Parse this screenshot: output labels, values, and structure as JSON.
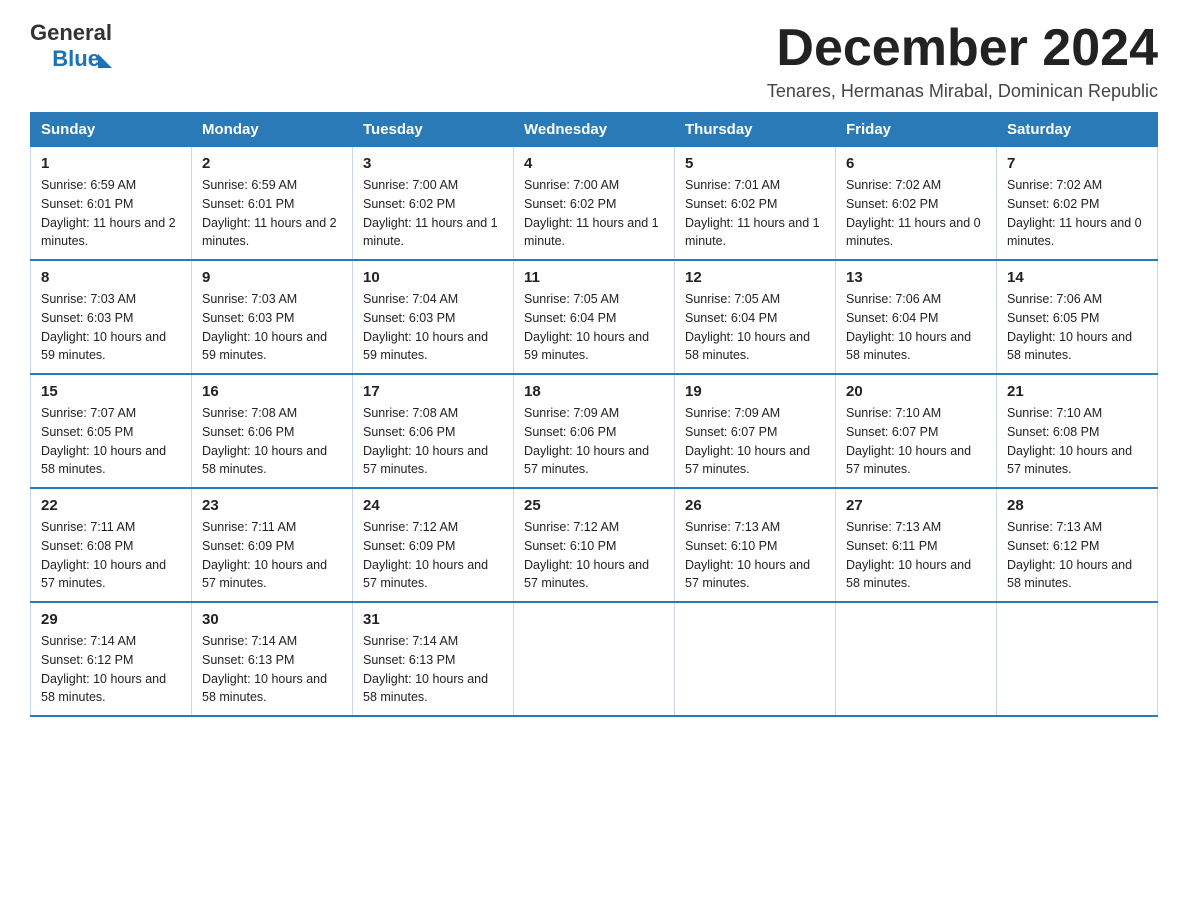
{
  "logo": {
    "general": "General",
    "blue": "Blue"
  },
  "title": "December 2024",
  "subtitle": "Tenares, Hermanas Mirabal, Dominican Republic",
  "days_of_week": [
    "Sunday",
    "Monday",
    "Tuesday",
    "Wednesday",
    "Thursday",
    "Friday",
    "Saturday"
  ],
  "weeks": [
    [
      {
        "day": "1",
        "sunrise": "6:59 AM",
        "sunset": "6:01 PM",
        "daylight": "11 hours and 2 minutes."
      },
      {
        "day": "2",
        "sunrise": "6:59 AM",
        "sunset": "6:01 PM",
        "daylight": "11 hours and 2 minutes."
      },
      {
        "day": "3",
        "sunrise": "7:00 AM",
        "sunset": "6:02 PM",
        "daylight": "11 hours and 1 minute."
      },
      {
        "day": "4",
        "sunrise": "7:00 AM",
        "sunset": "6:02 PM",
        "daylight": "11 hours and 1 minute."
      },
      {
        "day": "5",
        "sunrise": "7:01 AM",
        "sunset": "6:02 PM",
        "daylight": "11 hours and 1 minute."
      },
      {
        "day": "6",
        "sunrise": "7:02 AM",
        "sunset": "6:02 PM",
        "daylight": "11 hours and 0 minutes."
      },
      {
        "day": "7",
        "sunrise": "7:02 AM",
        "sunset": "6:02 PM",
        "daylight": "11 hours and 0 minutes."
      }
    ],
    [
      {
        "day": "8",
        "sunrise": "7:03 AM",
        "sunset": "6:03 PM",
        "daylight": "10 hours and 59 minutes."
      },
      {
        "day": "9",
        "sunrise": "7:03 AM",
        "sunset": "6:03 PM",
        "daylight": "10 hours and 59 minutes."
      },
      {
        "day": "10",
        "sunrise": "7:04 AM",
        "sunset": "6:03 PM",
        "daylight": "10 hours and 59 minutes."
      },
      {
        "day": "11",
        "sunrise": "7:05 AM",
        "sunset": "6:04 PM",
        "daylight": "10 hours and 59 minutes."
      },
      {
        "day": "12",
        "sunrise": "7:05 AM",
        "sunset": "6:04 PM",
        "daylight": "10 hours and 58 minutes."
      },
      {
        "day": "13",
        "sunrise": "7:06 AM",
        "sunset": "6:04 PM",
        "daylight": "10 hours and 58 minutes."
      },
      {
        "day": "14",
        "sunrise": "7:06 AM",
        "sunset": "6:05 PM",
        "daylight": "10 hours and 58 minutes."
      }
    ],
    [
      {
        "day": "15",
        "sunrise": "7:07 AM",
        "sunset": "6:05 PM",
        "daylight": "10 hours and 58 minutes."
      },
      {
        "day": "16",
        "sunrise": "7:08 AM",
        "sunset": "6:06 PM",
        "daylight": "10 hours and 58 minutes."
      },
      {
        "day": "17",
        "sunrise": "7:08 AM",
        "sunset": "6:06 PM",
        "daylight": "10 hours and 57 minutes."
      },
      {
        "day": "18",
        "sunrise": "7:09 AM",
        "sunset": "6:06 PM",
        "daylight": "10 hours and 57 minutes."
      },
      {
        "day": "19",
        "sunrise": "7:09 AM",
        "sunset": "6:07 PM",
        "daylight": "10 hours and 57 minutes."
      },
      {
        "day": "20",
        "sunrise": "7:10 AM",
        "sunset": "6:07 PM",
        "daylight": "10 hours and 57 minutes."
      },
      {
        "day": "21",
        "sunrise": "7:10 AM",
        "sunset": "6:08 PM",
        "daylight": "10 hours and 57 minutes."
      }
    ],
    [
      {
        "day": "22",
        "sunrise": "7:11 AM",
        "sunset": "6:08 PM",
        "daylight": "10 hours and 57 minutes."
      },
      {
        "day": "23",
        "sunrise": "7:11 AM",
        "sunset": "6:09 PM",
        "daylight": "10 hours and 57 minutes."
      },
      {
        "day": "24",
        "sunrise": "7:12 AM",
        "sunset": "6:09 PM",
        "daylight": "10 hours and 57 minutes."
      },
      {
        "day": "25",
        "sunrise": "7:12 AM",
        "sunset": "6:10 PM",
        "daylight": "10 hours and 57 minutes."
      },
      {
        "day": "26",
        "sunrise": "7:13 AM",
        "sunset": "6:10 PM",
        "daylight": "10 hours and 57 minutes."
      },
      {
        "day": "27",
        "sunrise": "7:13 AM",
        "sunset": "6:11 PM",
        "daylight": "10 hours and 58 minutes."
      },
      {
        "day": "28",
        "sunrise": "7:13 AM",
        "sunset": "6:12 PM",
        "daylight": "10 hours and 58 minutes."
      }
    ],
    [
      {
        "day": "29",
        "sunrise": "7:14 AM",
        "sunset": "6:12 PM",
        "daylight": "10 hours and 58 minutes."
      },
      {
        "day": "30",
        "sunrise": "7:14 AM",
        "sunset": "6:13 PM",
        "daylight": "10 hours and 58 minutes."
      },
      {
        "day": "31",
        "sunrise": "7:14 AM",
        "sunset": "6:13 PM",
        "daylight": "10 hours and 58 minutes."
      },
      null,
      null,
      null,
      null
    ]
  ]
}
